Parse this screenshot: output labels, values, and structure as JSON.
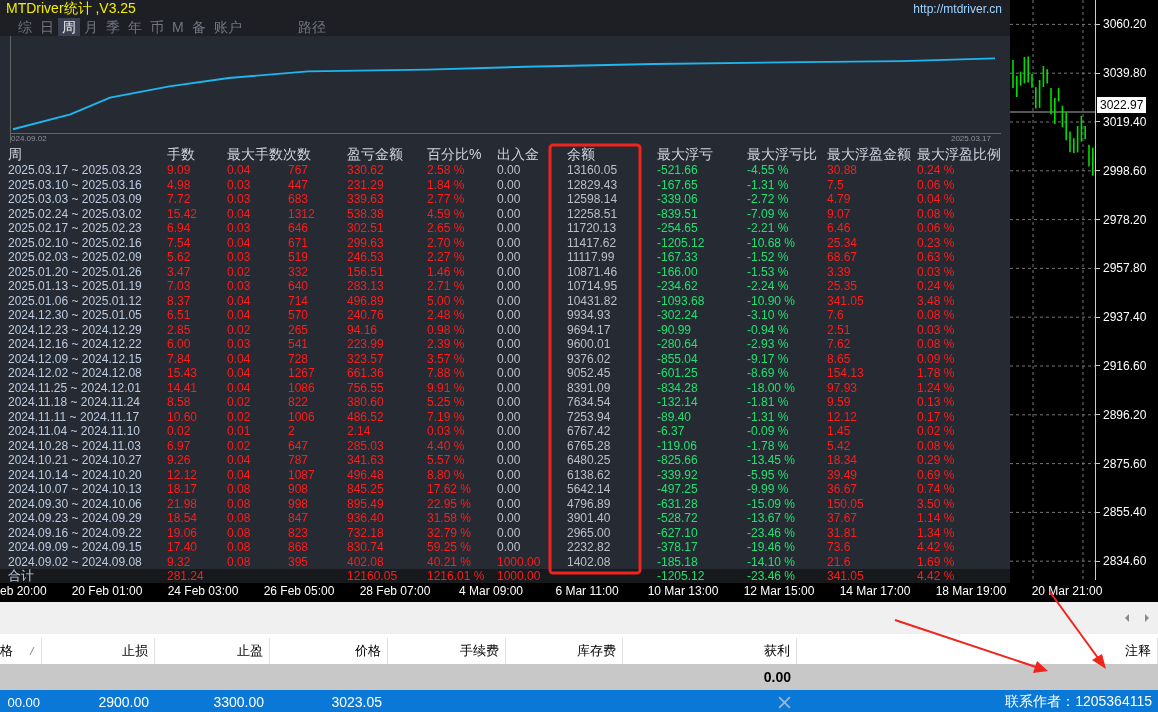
{
  "panel": {
    "title": "MTDriver统计 ,V3.25",
    "link": "http://mtdriver.cn",
    "tabs": [
      {
        "label": "综",
        "selected": false
      },
      {
        "label": "日",
        "selected": false
      },
      {
        "label": "周",
        "selected": true
      },
      {
        "label": "月",
        "selected": false
      },
      {
        "label": "季",
        "selected": false
      },
      {
        "label": "年",
        "selected": false
      },
      {
        "label": "币",
        "selected": false
      },
      {
        "label": "M",
        "selected": false
      },
      {
        "label": "备",
        "selected": false
      },
      {
        "label": "账户",
        "selected": false
      },
      {
        "label": "路径",
        "selected": false
      }
    ],
    "equity_chart": {
      "start_label": "024.09.02",
      "end_label": "2025.03.17"
    },
    "stats": {
      "columns": [
        "周",
        "手数",
        "最大手数次数",
        "盈亏金额",
        "百分比%",
        "出入金",
        "余额",
        "最大浮亏",
        "最大浮亏比",
        "最大浮盈金额",
        "最大浮盈比例"
      ],
      "rows": [
        {
          "week": "2025.03.17 ~ 2025.03.23",
          "lots": "9.09",
          "max_lot": "0.04",
          "max_lot_count": "767",
          "pnl": "330.62",
          "percent": "2.58 %",
          "deposit": "0.00",
          "balance": "13160.05",
          "max_float_loss": "-521.66",
          "max_float_loss_pct": "-4.55 %",
          "max_float_profit": "30.88",
          "max_float_profit_pct": "0.24 %",
          "deposit_highlighted": false
        },
        {
          "week": "2025.03.10 ~ 2025.03.16",
          "lots": "4.98",
          "max_lot": "0.03",
          "max_lot_count": "447",
          "pnl": "231.29",
          "percent": "1.84 %",
          "deposit": "0.00",
          "balance": "12829.43",
          "max_float_loss": "-167.65",
          "max_float_loss_pct": "-1.31 %",
          "max_float_profit": "7.5",
          "max_float_profit_pct": "0.06 %",
          "deposit_highlighted": false
        },
        {
          "week": "2025.03.03 ~ 2025.03.09",
          "lots": "7.72",
          "max_lot": "0.03",
          "max_lot_count": "683",
          "pnl": "339.63",
          "percent": "2.77 %",
          "deposit": "0.00",
          "balance": "12598.14",
          "max_float_loss": "-339.06",
          "max_float_loss_pct": "-2.72 %",
          "max_float_profit": "4.79",
          "max_float_profit_pct": "0.04 %",
          "deposit_highlighted": false
        },
        {
          "week": "2025.02.24 ~ 2025.03.02",
          "lots": "15.42",
          "max_lot": "0.04",
          "max_lot_count": "1312",
          "pnl": "538.38",
          "percent": "4.59 %",
          "deposit": "0.00",
          "balance": "12258.51",
          "max_float_loss": "-839.51",
          "max_float_loss_pct": "-7.09 %",
          "max_float_profit": "9.07",
          "max_float_profit_pct": "0.08 %",
          "deposit_highlighted": false
        },
        {
          "week": "2025.02.17 ~ 2025.02.23",
          "lots": "6.94",
          "max_lot": "0.03",
          "max_lot_count": "646",
          "pnl": "302.51",
          "percent": "2.65 %",
          "deposit": "0.00",
          "balance": "11720.13",
          "max_float_loss": "-254.65",
          "max_float_loss_pct": "-2.21 %",
          "max_float_profit": "6.46",
          "max_float_profit_pct": "0.06 %",
          "deposit_highlighted": false
        },
        {
          "week": "2025.02.10 ~ 2025.02.16",
          "lots": "7.54",
          "max_lot": "0.04",
          "max_lot_count": "671",
          "pnl": "299.63",
          "percent": "2.70 %",
          "deposit": "0.00",
          "balance": "11417.62",
          "max_float_loss": "-1205.12",
          "max_float_loss_pct": "-10.68 %",
          "max_float_profit": "25.34",
          "max_float_profit_pct": "0.23 %",
          "deposit_highlighted": false
        },
        {
          "week": "2025.02.03 ~ 2025.02.09",
          "lots": "5.62",
          "max_lot": "0.03",
          "max_lot_count": "519",
          "pnl": "246.53",
          "percent": "2.27 %",
          "deposit": "0.00",
          "balance": "11117.99",
          "max_float_loss": "-167.33",
          "max_float_loss_pct": "-1.52 %",
          "max_float_profit": "68.67",
          "max_float_profit_pct": "0.63 %",
          "deposit_highlighted": false
        },
        {
          "week": "2025.01.20 ~ 2025.01.26",
          "lots": "3.47",
          "max_lot": "0.02",
          "max_lot_count": "332",
          "pnl": "156.51",
          "percent": "1.46 %",
          "deposit": "0.00",
          "balance": "10871.46",
          "max_float_loss": "-166.00",
          "max_float_loss_pct": "-1.53 %",
          "max_float_profit": "3.39",
          "max_float_profit_pct": "0.03 %",
          "deposit_highlighted": false
        },
        {
          "week": "2025.01.13 ~ 2025.01.19",
          "lots": "7.03",
          "max_lot": "0.03",
          "max_lot_count": "640",
          "pnl": "283.13",
          "percent": "2.71 %",
          "deposit": "0.00",
          "balance": "10714.95",
          "max_float_loss": "-234.62",
          "max_float_loss_pct": "-2.24 %",
          "max_float_profit": "25.35",
          "max_float_profit_pct": "0.24 %",
          "deposit_highlighted": false
        },
        {
          "week": "2025.01.06 ~ 2025.01.12",
          "lots": "8.37",
          "max_lot": "0.04",
          "max_lot_count": "714",
          "pnl": "496.89",
          "percent": "5.00 %",
          "deposit": "0.00",
          "balance": "10431.82",
          "max_float_loss": "-1093.68",
          "max_float_loss_pct": "-10.90 %",
          "max_float_profit": "341.05",
          "max_float_profit_pct": "3.48 %",
          "deposit_highlighted": false
        },
        {
          "week": "2024.12.30 ~ 2025.01.05",
          "lots": "6.51",
          "max_lot": "0.04",
          "max_lot_count": "570",
          "pnl": "240.76",
          "percent": "2.48 %",
          "deposit": "0.00",
          "balance": "9934.93",
          "max_float_loss": "-302.24",
          "max_float_loss_pct": "-3.10 %",
          "max_float_profit": "7.6",
          "max_float_profit_pct": "0.08 %",
          "deposit_highlighted": false
        },
        {
          "week": "2024.12.23 ~ 2024.12.29",
          "lots": "2.85",
          "max_lot": "0.02",
          "max_lot_count": "265",
          "pnl": "94.16",
          "percent": "0.98 %",
          "deposit": "0.00",
          "balance": "9694.17",
          "max_float_loss": "-90.99",
          "max_float_loss_pct": "-0.94 %",
          "max_float_profit": "2.51",
          "max_float_profit_pct": "0.03 %",
          "deposit_highlighted": false
        },
        {
          "week": "2024.12.16 ~ 2024.12.22",
          "lots": "6.00",
          "max_lot": "0.03",
          "max_lot_count": "541",
          "pnl": "223.99",
          "percent": "2.39 %",
          "deposit": "0.00",
          "balance": "9600.01",
          "max_float_loss": "-280.64",
          "max_float_loss_pct": "-2.93 %",
          "max_float_profit": "7.62",
          "max_float_profit_pct": "0.08 %",
          "deposit_highlighted": false
        },
        {
          "week": "2024.12.09 ~ 2024.12.15",
          "lots": "7.84",
          "max_lot": "0.04",
          "max_lot_count": "728",
          "pnl": "323.57",
          "percent": "3.57 %",
          "deposit": "0.00",
          "balance": "9376.02",
          "max_float_loss": "-855.04",
          "max_float_loss_pct": "-9.17 %",
          "max_float_profit": "8.65",
          "max_float_profit_pct": "0.09 %",
          "deposit_highlighted": false
        },
        {
          "week": "2024.12.02 ~ 2024.12.08",
          "lots": "15.43",
          "max_lot": "0.04",
          "max_lot_count": "1267",
          "pnl": "661.36",
          "percent": "7.88 %",
          "deposit": "0.00",
          "balance": "9052.45",
          "max_float_loss": "-601.25",
          "max_float_loss_pct": "-8.69 %",
          "max_float_profit": "154.13",
          "max_float_profit_pct": "1.78 %",
          "deposit_highlighted": false
        },
        {
          "week": "2024.11.25 ~ 2024.12.01",
          "lots": "14.41",
          "max_lot": "0.04",
          "max_lot_count": "1086",
          "pnl": "756.55",
          "percent": "9.91 %",
          "deposit": "0.00",
          "balance": "8391.09",
          "max_float_loss": "-834.28",
          "max_float_loss_pct": "-18.00 %",
          "max_float_profit": "97.93",
          "max_float_profit_pct": "1.24 %",
          "deposit_highlighted": false
        },
        {
          "week": "2024.11.18 ~ 2024.11.24",
          "lots": "8.58",
          "max_lot": "0.02",
          "max_lot_count": "822",
          "pnl": "380.60",
          "percent": "5.25 %",
          "deposit": "0.00",
          "balance": "7634.54",
          "max_float_loss": "-132.14",
          "max_float_loss_pct": "-1.81 %",
          "max_float_profit": "9.59",
          "max_float_profit_pct": "0.13 %",
          "deposit_highlighted": false
        },
        {
          "week": "2024.11.11 ~ 2024.11.17",
          "lots": "10.60",
          "max_lot": "0.02",
          "max_lot_count": "1006",
          "pnl": "486.52",
          "percent": "7.19 %",
          "deposit": "0.00",
          "balance": "7253.94",
          "max_float_loss": "-89.40",
          "max_float_loss_pct": "-1.31 %",
          "max_float_profit": "12.12",
          "max_float_profit_pct": "0.17 %",
          "deposit_highlighted": false
        },
        {
          "week": "2024.11.04 ~ 2024.11.10",
          "lots": "0.02",
          "max_lot": "0.01",
          "max_lot_count": "2",
          "pnl": "2.14",
          "percent": "0.03 %",
          "deposit": "0.00",
          "balance": "6767.42",
          "max_float_loss": "-6.37",
          "max_float_loss_pct": "-0.09 %",
          "max_float_profit": "1.45",
          "max_float_profit_pct": "0.02 %",
          "deposit_highlighted": false
        },
        {
          "week": "2024.10.28 ~ 2024.11.03",
          "lots": "6.97",
          "max_lot": "0.02",
          "max_lot_count": "647",
          "pnl": "285.03",
          "percent": "4.40 %",
          "deposit": "0.00",
          "balance": "6765.28",
          "max_float_loss": "-119.06",
          "max_float_loss_pct": "-1.78 %",
          "max_float_profit": "5.42",
          "max_float_profit_pct": "0.08 %",
          "deposit_highlighted": false
        },
        {
          "week": "2024.10.21 ~ 2024.10.27",
          "lots": "9.26",
          "max_lot": "0.04",
          "max_lot_count": "787",
          "pnl": "341.63",
          "percent": "5.57 %",
          "deposit": "0.00",
          "balance": "6480.25",
          "max_float_loss": "-825.66",
          "max_float_loss_pct": "-13.45 %",
          "max_float_profit": "18.34",
          "max_float_profit_pct": "0.29 %",
          "deposit_highlighted": false
        },
        {
          "week": "2024.10.14 ~ 2024.10.20",
          "lots": "12.12",
          "max_lot": "0.04",
          "max_lot_count": "1087",
          "pnl": "496.48",
          "percent": "8.80 %",
          "deposit": "0.00",
          "balance": "6138.62",
          "max_float_loss": "-339.92",
          "max_float_loss_pct": "-5.95 %",
          "max_float_profit": "39.49",
          "max_float_profit_pct": "0.69 %",
          "deposit_highlighted": false
        },
        {
          "week": "2024.10.07 ~ 2024.10.13",
          "lots": "18.17",
          "max_lot": "0.08",
          "max_lot_count": "908",
          "pnl": "845.25",
          "percent": "17.62 %",
          "deposit": "0.00",
          "balance": "5642.14",
          "max_float_loss": "-497.25",
          "max_float_loss_pct": "-9.99 %",
          "max_float_profit": "36.67",
          "max_float_profit_pct": "0.74 %",
          "deposit_highlighted": false
        },
        {
          "week": "2024.09.30 ~ 2024.10.06",
          "lots": "21.98",
          "max_lot": "0.08",
          "max_lot_count": "998",
          "pnl": "895.49",
          "percent": "22.95 %",
          "deposit": "0.00",
          "balance": "4796.89",
          "max_float_loss": "-631.28",
          "max_float_loss_pct": "-15.09 %",
          "max_float_profit": "150.05",
          "max_float_profit_pct": "3.50 %",
          "deposit_highlighted": false
        },
        {
          "week": "2024.09.23 ~ 2024.09.29",
          "lots": "18.54",
          "max_lot": "0.08",
          "max_lot_count": "847",
          "pnl": "936.40",
          "percent": "31.58 %",
          "deposit": "0.00",
          "balance": "3901.40",
          "max_float_loss": "-528.72",
          "max_float_loss_pct": "-13.67 %",
          "max_float_profit": "37.67",
          "max_float_profit_pct": "1.14 %",
          "deposit_highlighted": false
        },
        {
          "week": "2024.09.16 ~ 2024.09.22",
          "lots": "19.06",
          "max_lot": "0.08",
          "max_lot_count": "823",
          "pnl": "732.18",
          "percent": "32.79 %",
          "deposit": "0.00",
          "balance": "2965.00",
          "max_float_loss": "-627.10",
          "max_float_loss_pct": "-23.46 %",
          "max_float_profit": "31.81",
          "max_float_profit_pct": "1.34 %",
          "deposit_highlighted": false
        },
        {
          "week": "2024.09.09 ~ 2024.09.15",
          "lots": "17.40",
          "max_lot": "0.08",
          "max_lot_count": "868",
          "pnl": "830.74",
          "percent": "59.25 %",
          "deposit": "0.00",
          "balance": "2232.82",
          "max_float_loss": "-378.17",
          "max_float_loss_pct": "-19.46 %",
          "max_float_profit": "73.6",
          "max_float_profit_pct": "4.42 %",
          "deposit_highlighted": false
        },
        {
          "week": "2024.09.02 ~ 2024.09.08",
          "lots": "9.32",
          "max_lot": "0.08",
          "max_lot_count": "395",
          "pnl": "402.08",
          "percent": "40.21 %",
          "deposit": "1000.00",
          "balance": "1402.08",
          "max_float_loss": "-185.18",
          "max_float_loss_pct": "-14.10 %",
          "max_float_profit": "21.6",
          "max_float_profit_pct": "1.69 %",
          "deposit_highlighted": true
        }
      ],
      "total": {
        "week": "合计",
        "lots": "281.24",
        "pnl": "12160.05",
        "percent": "1216.01 %",
        "deposit": "1000.00",
        "max_float_loss": "-1205.12",
        "max_float_loss_pct": "-23.46 %",
        "max_float_profit": "341.05",
        "max_float_profit_pct": "4.42 %",
        "deposit_highlighted": true
      }
    }
  },
  "price_axis": {
    "labels": [
      "3060.20",
      "3039.80",
      "3019.40",
      "2998.60",
      "2978.20",
      "2957.80",
      "2937.40",
      "2916.60",
      "2896.20",
      "2875.60",
      "2855.40",
      "2834.60"
    ],
    "current_price": "3022.97"
  },
  "time_axis": [
    "eb 20:00",
    "20 Feb 01:00",
    "24 Feb 03:00",
    "26 Feb 05:00",
    "28 Feb 07:00",
    "4 Mar 09:00",
    "6 Mar 11:00",
    "10 Mar 13:00",
    "12 Mar 15:00",
    "14 Mar 17:00",
    "18 Mar 19:00",
    "20 Mar 21:00"
  ],
  "orders": {
    "columns": [
      "格",
      "止损",
      "止盈",
      "价格",
      "手续费",
      "库存费",
      "获利",
      "注释"
    ],
    "summary_profit": "0.00",
    "row": {
      "price_open": "00.00",
      "stop_loss": "2900.00",
      "take_profit": "3300.00",
      "price": "3023.05",
      "comment": "联系作者：1205364115",
      "selected": true
    }
  }
}
